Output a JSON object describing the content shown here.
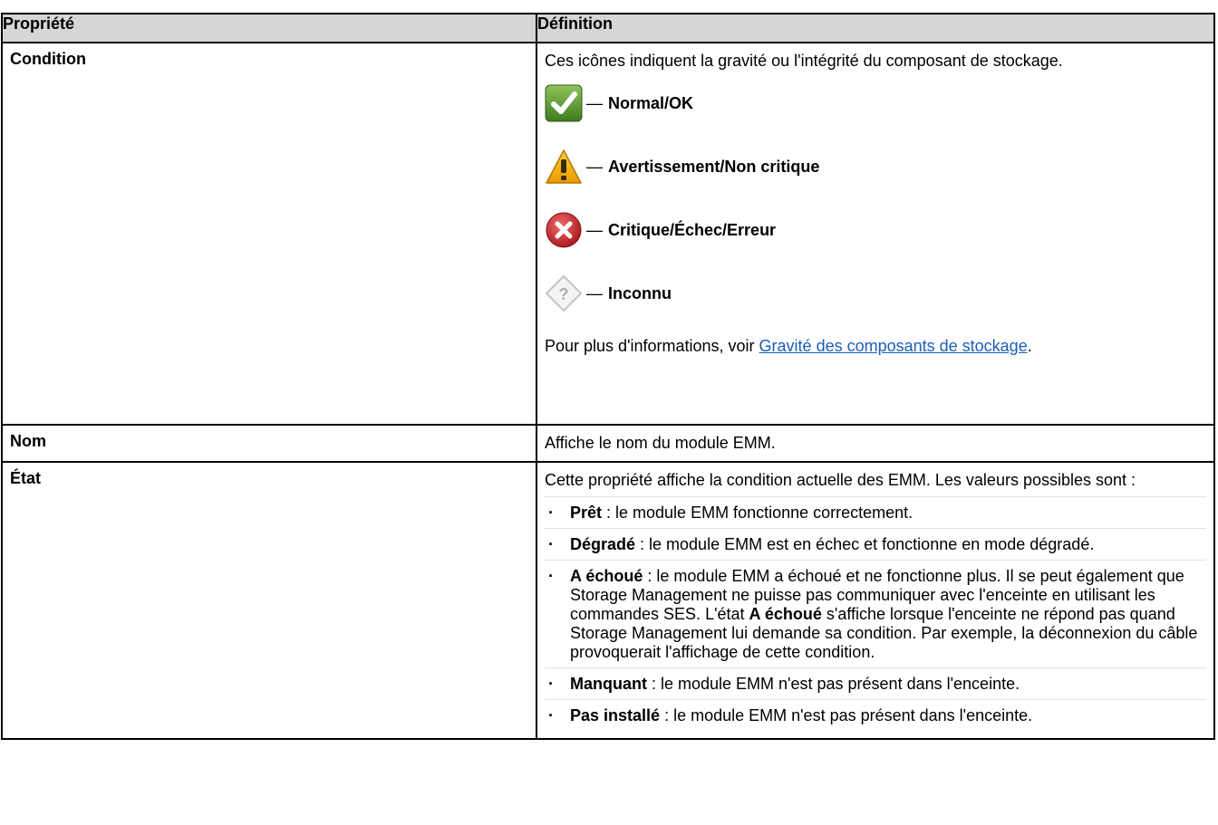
{
  "table": {
    "header": {
      "property": "Propriété",
      "definition": "Définition"
    },
    "rows": {
      "condition": {
        "name": "Condition",
        "intro": "Ces icônes indiquent la gravité ou l'intégrité du composant de stockage.",
        "icons": [
          {
            "icon": "check-icon",
            "dash": "—",
            "label": "Normal/OK",
            "color": "#4e8d2c"
          },
          {
            "icon": "warning-icon",
            "dash": "—",
            "label": "Avertissement/Non critique",
            "color": "#f2a900"
          },
          {
            "icon": "error-icon",
            "dash": "—",
            "label": "Critique/Échec/Erreur",
            "color": "#c8262c"
          },
          {
            "icon": "unknown-icon",
            "dash": "—",
            "label": "Inconnu",
            "color": "#c9c9c9"
          }
        ],
        "note_prefix": "Pour plus d'informations, voir ",
        "note_link": "Gravité des composants de stockage",
        "note_suffix": "."
      },
      "name": {
        "name": "Nom",
        "definition": "Affiche le nom du module EMM."
      },
      "state": {
        "name": "État",
        "intro": "Cette propriété affiche la condition actuelle des EMM. Les valeurs possibles sont :",
        "items": [
          {
            "term": "Prêt",
            "text": " : le module EMM fonctionne correctement."
          },
          {
            "term": "Dégradé",
            "text": " : le module EMM est en échec et fonctionne en mode dégradé."
          },
          {
            "term": "A échoué",
            "text": " : le module EMM a échoué et ne fonctionne plus. Il se peut également que Storage Management ne puisse pas communiquer avec l'enceinte en utilisant les commandes SES. L'état ",
            "term2": "A échoué",
            "text2": " s'affiche lorsque l'enceinte ne répond pas quand Storage Management lui demande sa condition. Par exemple, la déconnexion du câble provoquerait l'affichage de cette condition."
          },
          {
            "term": "Manquant",
            "text": " : le module EMM n'est pas présent dans l'enceinte."
          },
          {
            "term": "Pas installé",
            "text": " : le module EMM n'est pas présent dans l'enceinte."
          }
        ]
      }
    }
  }
}
